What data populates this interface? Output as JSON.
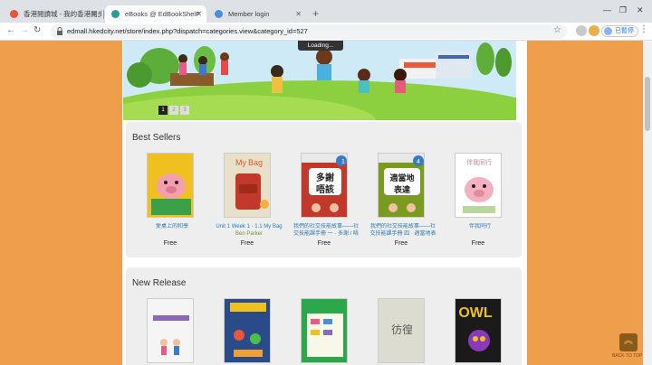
{
  "browser": {
    "tabs": [
      {
        "label": "香港閱讀城 - 我的香港閱步書",
        "active": false
      },
      {
        "label": "eBooks @ EdBookShelF",
        "active": true
      },
      {
        "label": "Member login",
        "active": false
      }
    ],
    "url": "edmall.hkedcity.net/store/index.php?dispatch=categories.view&category_id=527",
    "profile_label": "已暫停"
  },
  "banner": {
    "loading_label": "Loading...",
    "pages": [
      "1",
      "2",
      "3"
    ]
  },
  "best_sellers": {
    "title": "Best Sellers",
    "books": [
      {
        "title": "愛桌上的和學",
        "author": "",
        "price": "Free",
        "cover_color": "#f0c020"
      },
      {
        "title": "Unit 1 Week 1 - 1.1 My Bag",
        "author": "Ben Parker",
        "price": "Free",
        "cover_color": "#e8e0c8"
      },
      {
        "title": "我們的社交技能故事——社交技能課手冊 一 · 多謝 / 唔該",
        "author": "",
        "price": "Free",
        "cover_color": "#c0392b",
        "cover_text": "多謝\n唔該"
      },
      {
        "title": "我們的社交技能故事——社交技能課手冊 四 · 適當地表達",
        "author": "",
        "price": "Free",
        "cover_color": "#7a9a20",
        "cover_text": "適當地\n表達"
      },
      {
        "title": "伴我同行",
        "author": "",
        "price": "Free",
        "cover_color": "#ffffff"
      }
    ]
  },
  "new_release": {
    "title": "New Release",
    "books": [
      {
        "cover_color": "#f5f5f5"
      },
      {
        "cover_color": "#2a4a8a"
      },
      {
        "cover_color": "#2aa84a"
      },
      {
        "cover_color": "#dcdcd0"
      },
      {
        "cover_color": "#1a1a1a"
      }
    ]
  },
  "back_to_top": "BACK TO TOP"
}
